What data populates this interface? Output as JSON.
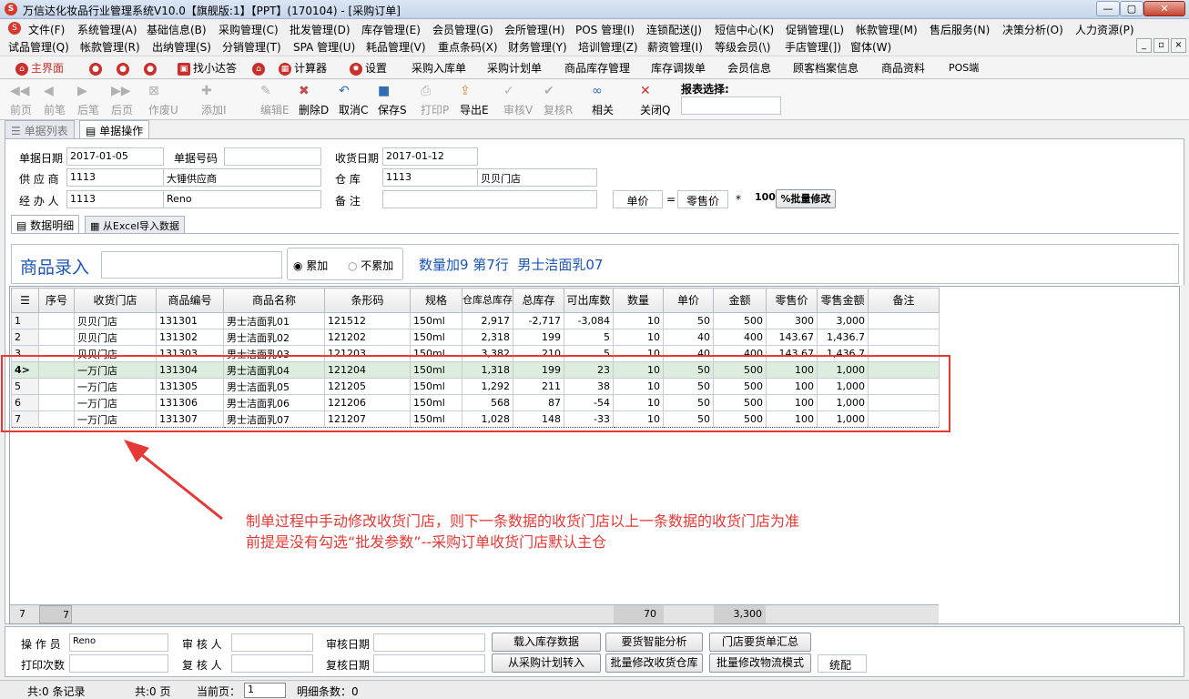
{
  "window": {
    "title": "万信达化妆品行业管理系统V10.0【旗舰版:1】【PPT】(170104) - [采购订单]",
    "logo": "S",
    "min": "—",
    "restore": "▢",
    "close": "✕"
  },
  "menu1": [
    "文件(F)",
    "系统管理(A)",
    "基础信息(B)",
    "采购管理(C)",
    "批发管理(D)",
    "库存管理(E)",
    "会员管理(G)",
    "会所管理(H)",
    "POS 管理(I)",
    "连锁配送(J)",
    "短信中心(K)",
    "促销管理(L)",
    "帐款管理(M)",
    "售后服务(N)",
    "决策分析(O)",
    "人力资源(P)"
  ],
  "menu2": [
    "试品管理(Q)",
    "帐款管理(R)",
    "出纳管理(S)",
    "分销管理(T)",
    "SPA 管理(U)",
    "耗品管理(V)",
    "重点条码(X)",
    "财务管理(Y)",
    "培训管理(Z)",
    "薪资管理(I)",
    "等级会员(\\)",
    "手店管理(])",
    "窗体(W)"
  ],
  "mdi": {
    "min": "_",
    "restore": "▫",
    "close": "×"
  },
  "quick": [
    "主界面",
    "找小达答",
    "计算器",
    "设置",
    "采购入库单",
    "采购计划单",
    "商品库存管理",
    "库存调拨单",
    "会员信息",
    "顾客档案信息",
    "商品资料",
    "POS端"
  ],
  "toolbar": {
    "buttons": [
      {
        "label": "前页",
        "icon": "◀◀"
      },
      {
        "label": "前笔",
        "icon": "◀"
      },
      {
        "label": "后笔",
        "icon": "▶"
      },
      {
        "label": "后页",
        "icon": "▶▶"
      },
      {
        "label": "作废U",
        "icon": "⊠"
      },
      {
        "label": "添加I",
        "icon": "✚"
      },
      {
        "label": "编辑E",
        "icon": "✎"
      },
      {
        "label": "删除D",
        "icon": "✖"
      },
      {
        "label": "取消C",
        "icon": "↶"
      },
      {
        "label": "保存S",
        "icon": "■"
      },
      {
        "label": "打印P",
        "icon": "⎙"
      },
      {
        "label": "导出E",
        "icon": "⇪"
      },
      {
        "label": "审核V",
        "icon": "✓"
      },
      {
        "label": "复核R",
        "icon": "✔"
      },
      {
        "label": "相关",
        "icon": "∞"
      },
      {
        "label": "关闭Q",
        "icon": "✕"
      }
    ],
    "report_label": "报表选择:",
    "report_value": ""
  },
  "tabs": {
    "list": "单据列表",
    "op": "单据操作"
  },
  "form": {
    "date_label": "单据日期",
    "date": "2017-01-05",
    "no_label": "单据号码",
    "no": "",
    "recv_label": "收货日期",
    "recv": "2017-01-12",
    "supplier_label": "供 应 商",
    "supplier_code": "1113",
    "supplier_name": "大锤供应商",
    "wh_label": "仓    库",
    "wh_code": "1113",
    "wh_name": "贝贝门店",
    "handler_label": "经 办 人",
    "handler_code": "1113",
    "handler_name": "Reno",
    "remark_label": "备    注",
    "remark": "",
    "price_label": "单价",
    "eq": "=",
    "retail_label": "零售价",
    "mul": "*",
    "pct": "100",
    "batch_btn": "%批量修改"
  },
  "subtabs": {
    "detail": "数据明细",
    "excel": "从Excel导入数据"
  },
  "entry": {
    "title": "商品录入",
    "value": "",
    "accum": "累加",
    "noaccum": "不累加",
    "info": "数量加9 第7行  男士洁面乳07"
  },
  "grid": {
    "headers": [
      "序号",
      "收货门店",
      "商品编号",
      "商品名称",
      "条形码",
      "规格",
      "仓库总库存",
      "总库存",
      "可出库数",
      "数量",
      "单价",
      "金额",
      "零售价",
      "零售金额",
      "备注"
    ],
    "rows": [
      [
        "1",
        "",
        "贝贝门店",
        "131301",
        "男士洁面乳01",
        "121512",
        "150ml",
        "2,917",
        "-2,717",
        "-3,084",
        "10",
        "50",
        "500",
        "300",
        "3,000",
        ""
      ],
      [
        "2",
        "",
        "贝贝门店",
        "131302",
        "男士洁面乳02",
        "121202",
        "150ml",
        "2,318",
        "199",
        "5",
        "10",
        "40",
        "400",
        "143.67",
        "1,436.7",
        ""
      ],
      [
        "3",
        "",
        "贝贝门店",
        "131303",
        "男士洁面乳03",
        "121203",
        "150ml",
        "3,382",
        "210",
        "5",
        "10",
        "40",
        "400",
        "143.67",
        "1,436.7",
        ""
      ],
      [
        "4>",
        "",
        "一万门店",
        "131304",
        "男士洁面乳04",
        "121204",
        "150ml",
        "1,318",
        "199",
        "23",
        "10",
        "50",
        "500",
        "100",
        "1,000",
        ""
      ],
      [
        "5",
        "",
        "一万门店",
        "131305",
        "男士洁面乳05",
        "121205",
        "150ml",
        "1,292",
        "211",
        "38",
        "10",
        "50",
        "500",
        "100",
        "1,000",
        ""
      ],
      [
        "6",
        "",
        "一万门店",
        "131306",
        "男士洁面乳06",
        "121206",
        "150ml",
        "568",
        "87",
        "-54",
        "10",
        "50",
        "500",
        "100",
        "1,000",
        ""
      ],
      [
        "7",
        "",
        "一万门店",
        "131307",
        "男士洁面乳07",
        "121207",
        "150ml",
        "1,028",
        "148",
        "-33",
        "10",
        "50",
        "500",
        "100",
        "1,000",
        ""
      ]
    ],
    "summary": {
      "count": "7",
      "seq": "7",
      "qty": "70",
      "amount": "3,300"
    }
  },
  "annotation": {
    "line1": "制单过程中手动修改收货门店，则下一条数据的收货门店以上一条数据的收货门店为准",
    "line2": "前提是没有勾选“批发参数”--采购订单收货门店默认主仓"
  },
  "bottom": {
    "operator_label": "操 作 员",
    "operator": "Reno",
    "auditor_label": "审 核 人",
    "auditor": "",
    "audit_date_label": "审核日期",
    "audit_date": "",
    "print_label": "打印次数",
    "print": "",
    "reviewer_label": "复 核 人",
    "reviewer": "",
    "review_date_label": "复核日期",
    "review_date": "",
    "btn_load": "载入库存数据",
    "btn_smart": "要货智能分析",
    "btn_summary": "门店要货单汇总",
    "btn_plan": "从采购计划转入",
    "btn_batch_wh": "批量修改收货仓库",
    "btn_batch_log": "批量修改物流模式",
    "mode": "统配"
  },
  "status": {
    "records": "共:0 条记录",
    "pages": "共:0 页",
    "cur_label": "当前页：",
    "cur": "1",
    "detail": "明细条数：0"
  }
}
